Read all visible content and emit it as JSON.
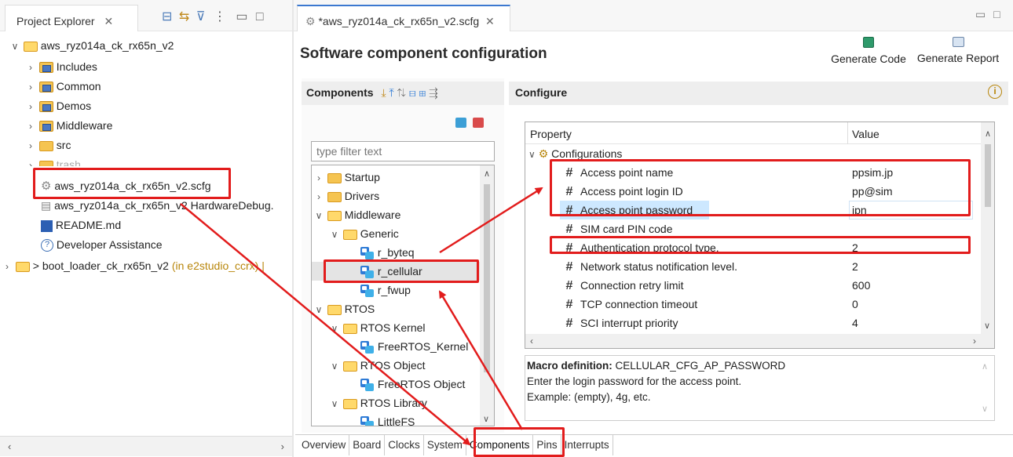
{
  "left": {
    "tab_title": "Project Explorer",
    "tree": [
      {
        "label": "aws_ryz014a_ck_rx65n_v2",
        "kind": "project"
      },
      {
        "label": "Includes",
        "kind": "includes"
      },
      {
        "label": "Common",
        "kind": "pkg"
      },
      {
        "label": "Demos",
        "kind": "pkg"
      },
      {
        "label": "Middleware",
        "kind": "pkg"
      },
      {
        "label": "src",
        "kind": "folder"
      },
      {
        "label": "trash",
        "kind": "folder"
      },
      {
        "label": "aws_ryz014a_ck_rx65n_v2.scfg",
        "kind": "scfg"
      },
      {
        "label": "aws_ryz014a_ck_rx65n_v2 HardwareDebug.",
        "kind": "file"
      },
      {
        "label": "README.md",
        "kind": "md"
      },
      {
        "label": "Developer Assistance",
        "kind": "help"
      },
      {
        "label": "> boot_loader_ck_rx65n_v2",
        "suffix": "(in e2studio_ccrx) |",
        "kind": "project"
      }
    ]
  },
  "editor": {
    "tab_title": "*aws_ryz014a_ck_rx65n_v2.scfg",
    "heading": "Software component configuration",
    "generate_code": "Generate Code",
    "generate_report": "Generate Report"
  },
  "components": {
    "title": "Components",
    "filter_placeholder": "type filter text",
    "tree": [
      {
        "label": "Startup"
      },
      {
        "label": "Drivers"
      },
      {
        "label": "Middleware"
      },
      {
        "label": "Generic"
      },
      {
        "label": "r_byteq"
      },
      {
        "label": "r_cellular"
      },
      {
        "label": "r_fwup"
      },
      {
        "label": "RTOS"
      },
      {
        "label": "RTOS Kernel"
      },
      {
        "label": "FreeRTOS_Kernel"
      },
      {
        "label": "RTOS Object"
      },
      {
        "label": "FreeRTOS Object"
      },
      {
        "label": "RTOS Library"
      },
      {
        "label": "LittleFS"
      }
    ]
  },
  "configure": {
    "title": "Configure",
    "col_property": "Property",
    "col_value": "Value",
    "group": "Configurations",
    "rows": [
      {
        "name": "Access point name",
        "value": "ppsim.jp"
      },
      {
        "name": "Access point login ID",
        "value": "pp@sim"
      },
      {
        "name": "Access point password",
        "value": "jpn"
      },
      {
        "name": "SIM card PIN code",
        "value": ""
      },
      {
        "name": "Authentication protocol type.",
        "value": "2"
      },
      {
        "name": "Network status notification level.",
        "value": "2"
      },
      {
        "name": "Connection retry limit",
        "value": "600"
      },
      {
        "name": "TCP connection timeout",
        "value": "0"
      },
      {
        "name": "SCI interrupt priority",
        "value": "4"
      }
    ],
    "macro_label": "Macro definition:",
    "macro_value": "CELLULAR_CFG_AP_PASSWORD",
    "desc_line1": "Enter the login password for the access point.",
    "desc_line2": "Example: (empty), 4g, etc."
  },
  "bottom_tabs": [
    "Overview",
    "Board",
    "Clocks",
    "System",
    "Components",
    "Pins",
    "Interrupts"
  ],
  "colors": {
    "highlight": "#e21c1c",
    "selection": "#cde8ff",
    "link_suffix": "#b8860b"
  }
}
